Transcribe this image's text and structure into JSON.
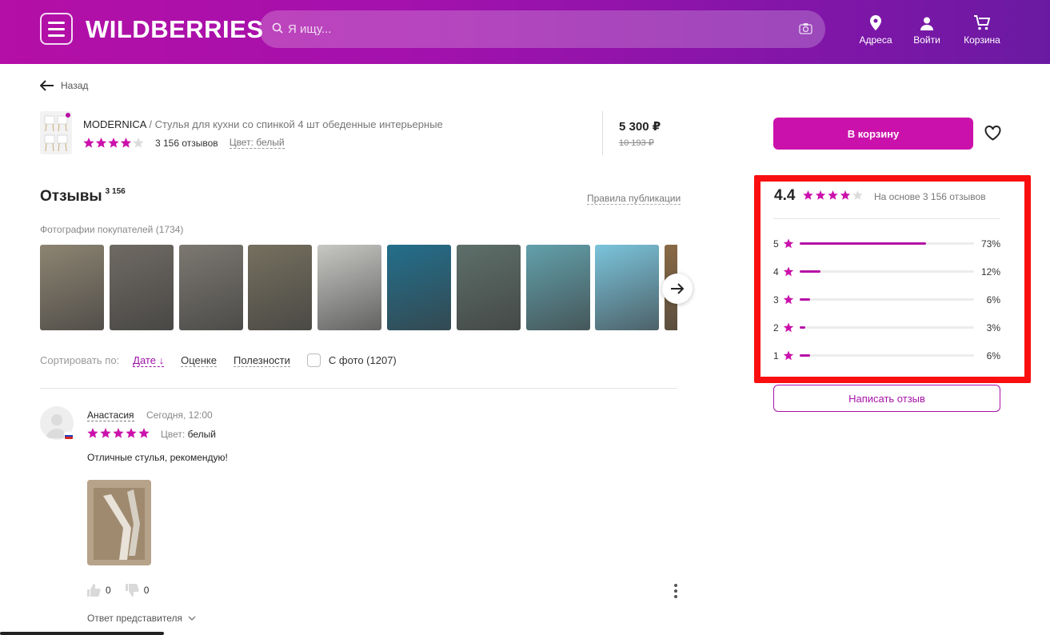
{
  "header": {
    "logo": "WILDBERRIES",
    "search_placeholder": "Я ищу...",
    "nav": [
      {
        "label": "Адреса",
        "icon": "location-pin-icon"
      },
      {
        "label": "Войти",
        "icon": "user-icon"
      },
      {
        "label": "Корзина",
        "icon": "cart-icon"
      }
    ],
    "brand_color": "#b40fa6"
  },
  "back_label": "Назад",
  "product": {
    "brand": "MODERNICA",
    "name": " / Стулья для кухни со спинкой 4 шт обеденные интерьерные",
    "rating_stars": 4,
    "reviews_count": "3 156 отзывов",
    "color": "Цвет: белый",
    "price": "5 300 ₽",
    "old_price": "10 193 ₽",
    "add_to_cart": "В корзину"
  },
  "reviews": {
    "title": "Отзывы",
    "count": "3 156",
    "rules_link": "Правила публикации",
    "photos_label": "Фотографии покупателей (1734)",
    "photos": [
      {
        "name": "photo-1",
        "color": "#8d8472"
      },
      {
        "name": "photo-2",
        "color": "#6f6a63"
      },
      {
        "name": "photo-3",
        "color": "#7c7871"
      },
      {
        "name": "photo-4",
        "color": "#75705f"
      },
      {
        "name": "photo-5",
        "color": "#c7c8c4"
      },
      {
        "name": "photo-6",
        "color": "#236f8c"
      },
      {
        "name": "photo-7",
        "color": "#5e6f6a"
      },
      {
        "name": "photo-8",
        "color": "#62a0ab"
      },
      {
        "name": "photo-9",
        "color": "#7bc4dc"
      },
      {
        "name": "photo-10",
        "color": "#8a6a45"
      }
    ],
    "sort_label": "Сортировать по:",
    "sort_options": [
      "Дате",
      "Оценке",
      "Полезности"
    ],
    "with_photo_label": "С фото (1207)"
  },
  "review": {
    "author": "Анастасия",
    "date": "Сегодня, 12:00",
    "stars": 5,
    "color_label": "Цвет:",
    "color_value": "белый",
    "text": "Отличные стулья, рекомендую!",
    "likes": "0",
    "dislikes": "0",
    "reply_label": "Ответ представителя"
  },
  "rating_panel": {
    "average": "4.4",
    "stars": 4.4,
    "basis": "На основе 3 156 отзывов",
    "distribution": [
      {
        "stars": "5",
        "percent": 73,
        "label": "73%"
      },
      {
        "stars": "4",
        "percent": 12,
        "label": "12%"
      },
      {
        "stars": "3",
        "percent": 6,
        "label": "6%"
      },
      {
        "stars": "2",
        "percent": 3,
        "label": "3%"
      },
      {
        "stars": "1",
        "percent": 6,
        "label": "6%"
      }
    ],
    "write_review": "Написать отзыв",
    "highlight_color": "#f90f0f"
  }
}
